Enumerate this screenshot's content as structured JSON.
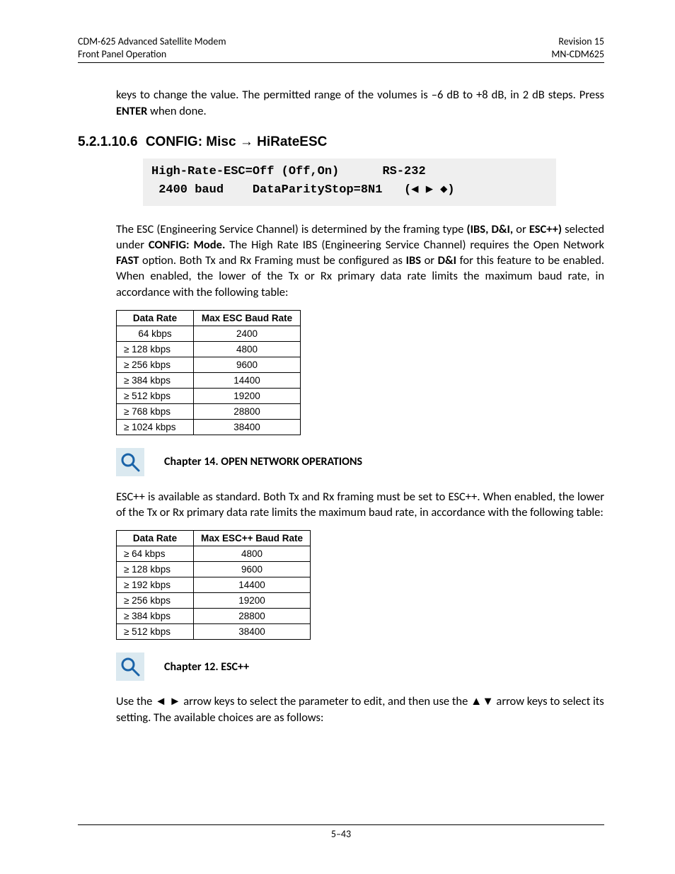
{
  "header": {
    "left1": "CDM-625 Advanced Satellite Modem",
    "left2": "Front Panel Operation",
    "right1": "Revision 15",
    "right2": "MN-CDM625"
  },
  "intro": {
    "line1_a": "keys to change the value. The permitted range of the volumes is –6 dB to +8 dB, in 2 dB steps. Press ",
    "line1_b": "ENTER",
    "line1_c": " when done."
  },
  "section": {
    "num": "5.2.1.10.6",
    "title_a": "CONFIG: Misc ",
    "title_arrow": "→",
    "title_b": " HiRateESC"
  },
  "lcd": {
    "line1": "High-Rate-ESC=Off (Off,On)      RS-232",
    "line2": " 2400 baud    DataParityStop=8N1   (◀ ▶ ◆)"
  },
  "p1": {
    "a": "The ESC (Engineering Service Channel) is determined by the framing type ",
    "b": "(IBS, D&I,",
    "c": " or ",
    "d": "ESC++)",
    "e": " selected under ",
    "f": "CONFIG: Mode.",
    "g": " The High Rate IBS (Engineering Service Channel) requires the Open Network ",
    "h": "FAST",
    "i": " option. Both Tx and Rx Framing must be configured as ",
    "j": "IBS",
    "k": " or ",
    "l": "D&I",
    "m": " for this feature to be enabled. When enabled, the lower of the Tx or Rx primary data rate limits the maximum baud rate, in accordance with the following table:"
  },
  "table1": {
    "h1": "Data Rate",
    "h2": "Max ESC Baud Rate",
    "rows": [
      {
        "c1": "64 kbps",
        "c2": "2400"
      },
      {
        "c1": "≥ 128 kbps",
        "c2": "4800"
      },
      {
        "c1": "≥ 256 kbps",
        "c2": "9600"
      },
      {
        "c1": "≥ 384 kbps",
        "c2": "14400"
      },
      {
        "c1": "≥ 512 kbps",
        "c2": "19200"
      },
      {
        "c1": "≥ 768 kbps",
        "c2": "28800"
      },
      {
        "c1": "≥ 1024 kbps",
        "c2": "38400"
      }
    ]
  },
  "xref1": "Chapter 14. OPEN NETWORK OPERATIONS",
  "p2": "ESC++ is available as standard. Both Tx and Rx framing must be set to ESC++. When enabled, the lower of the Tx or Rx primary data rate limits the maximum baud rate, in accordance with the following table:",
  "table2": {
    "h1": "Data Rate",
    "h2": "Max ESC++ Baud Rate",
    "rows": [
      {
        "c1": "≥ 64 kbps",
        "c2": "4800"
      },
      {
        "c1": "≥ 128 kbps",
        "c2": "9600"
      },
      {
        "c1": "≥ 192 kbps",
        "c2": "14400"
      },
      {
        "c1": "≥ 256 kbps",
        "c2": "19200"
      },
      {
        "c1": "≥ 384 kbps",
        "c2": "28800"
      },
      {
        "c1": "≥ 512 kbps",
        "c2": "38400"
      }
    ]
  },
  "xref2": "Chapter 12. ESC++",
  "p3": {
    "a": "Use the ",
    "b": "◄ ►",
    "c": " arrow keys to select the parameter to edit, and then use the ",
    "d": "▲▼",
    "e": " arrow keys to select its setting. The available choices are as follows:"
  },
  "footer": "5–43"
}
